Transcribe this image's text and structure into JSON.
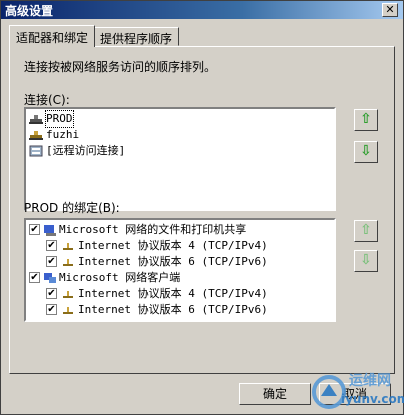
{
  "window": {
    "title": "高级设置",
    "close_glyph": "✕"
  },
  "tabs": [
    {
      "label": "适配器和绑定",
      "active": true
    },
    {
      "label": "提供程序顺序",
      "active": false
    }
  ],
  "description": "连接按被网络服务访问的顺序排列。",
  "connections": {
    "label": "连接(C):",
    "items": [
      {
        "label": "PROD",
        "icon": "network-adapter-icon",
        "selected": true
      },
      {
        "label": "fuzhi",
        "icon": "network-adapter-icon",
        "selected": false
      },
      {
        "label": "[远程访问连接]",
        "icon": "remote-access-icon",
        "selected": false
      }
    ]
  },
  "bindings": {
    "label": "PROD 的绑定(B):",
    "items": [
      {
        "label": "Microsoft 网络的文件和打印机共享",
        "level": 0,
        "checked": true,
        "icon": "file-printer-sharing-icon"
      },
      {
        "label": "Internet 协议版本 4 (TCP/IPv4)",
        "level": 1,
        "checked": true,
        "icon": "protocol-icon"
      },
      {
        "label": "Internet 协议版本 6 (TCP/IPv6)",
        "level": 1,
        "checked": true,
        "icon": "protocol-icon"
      },
      {
        "label": "Microsoft 网络客户端",
        "level": 0,
        "checked": true,
        "icon": "network-client-icon"
      },
      {
        "label": "Internet 协议版本 4 (TCP/IPv4)",
        "level": 1,
        "checked": true,
        "icon": "protocol-icon"
      },
      {
        "label": "Internet 协议版本 6 (TCP/IPv6)",
        "level": 1,
        "checked": true,
        "icon": "protocol-icon"
      }
    ]
  },
  "buttons": {
    "ok": "确定",
    "cancel": "取消"
  },
  "watermark": {
    "line1": "运维网",
    "line2": "iyunv.com"
  },
  "colors": {
    "arrow_up": "#2e9e2e",
    "arrow_down": "#2e9e2e",
    "title_bar": "#0a246a"
  }
}
